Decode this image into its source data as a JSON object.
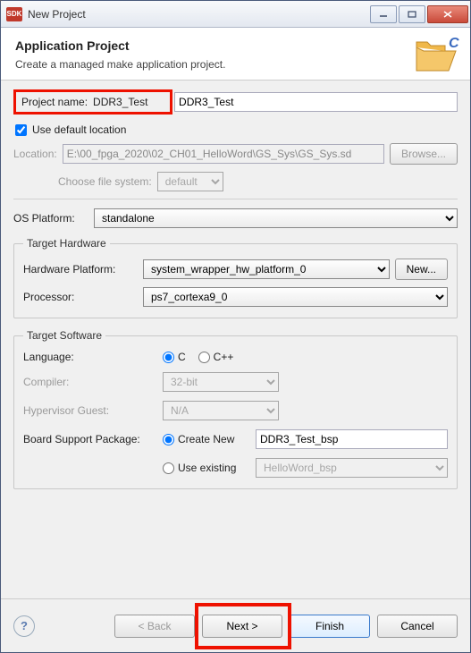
{
  "window": {
    "title": "New Project"
  },
  "header": {
    "title": "Application Project",
    "subtitle": "Create a managed make application project."
  },
  "project_name": {
    "label": "Project name:",
    "value": "DDR3_Test"
  },
  "default_location": {
    "label": "Use default location",
    "checked": true
  },
  "location": {
    "label": "Location:",
    "value": "E:\\00_fpga_2020\\02_CH01_HelloWord\\GS_Sys\\GS_Sys.sd",
    "browse": "Browse..."
  },
  "file_system": {
    "label": "Choose file system:",
    "value": "default"
  },
  "os_platform": {
    "label": "OS Platform:",
    "value": "standalone"
  },
  "target_hardware": {
    "legend": "Target Hardware",
    "hw_platform_label": "Hardware Platform:",
    "hw_platform_value": "system_wrapper_hw_platform_0",
    "new_btn": "New...",
    "processor_label": "Processor:",
    "processor_value": "ps7_cortexa9_0"
  },
  "target_software": {
    "legend": "Target Software",
    "language_label": "Language:",
    "lang_c": "C",
    "lang_cpp": "C++",
    "compiler_label": "Compiler:",
    "compiler_value": "32-bit",
    "hypervisor_label": "Hypervisor Guest:",
    "hypervisor_value": "N/A",
    "bsp_label": "Board Support Package:",
    "bsp_create": "Create New",
    "bsp_create_value": "DDR3_Test_bsp",
    "bsp_existing": "Use existing",
    "bsp_existing_value": "HelloWord_bsp"
  },
  "footer": {
    "back": "< Back",
    "next": "Next >",
    "finish": "Finish",
    "cancel": "Cancel"
  }
}
